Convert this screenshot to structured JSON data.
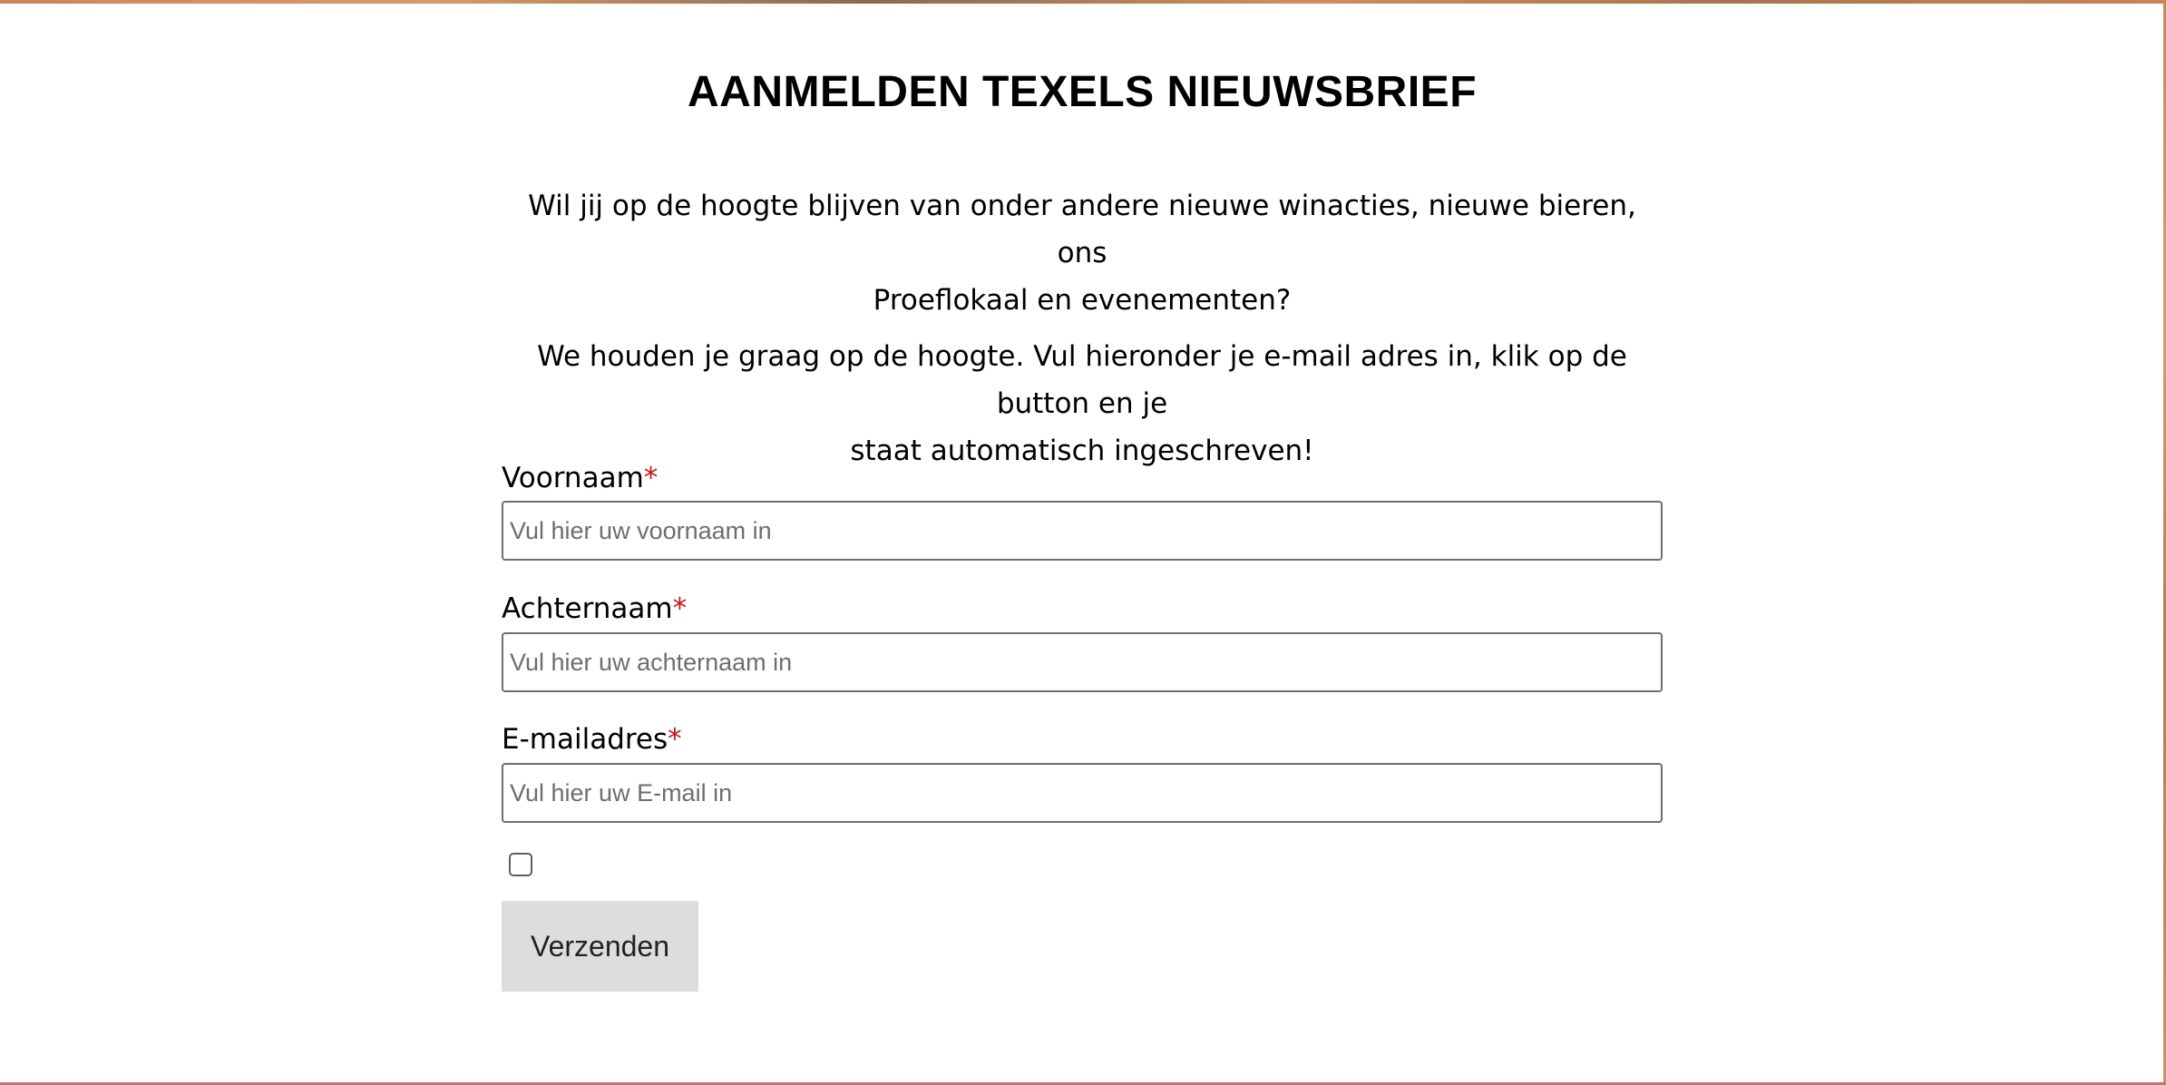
{
  "page": {
    "title": "AANMELDEN TEXELS NIEUWSBRIEF",
    "intro_paragraph_1_line_1": "Wil jij op de hoogte blijven van onder andere nieuwe winacties, nieuwe bieren, ons",
    "intro_paragraph_1_line_2": "Proeflokaal en evenementen?",
    "intro_paragraph_2_line_1": "We houden je graag op de hoogte. Vul hieronder je e-mail adres in, klik op de button en je",
    "intro_paragraph_2_line_2": "staat automatisch ingeschreven!"
  },
  "form": {
    "required_marker": "*",
    "first_name": {
      "label": "Voornaam",
      "value": "",
      "placeholder": "Vul hier uw voornaam in"
    },
    "last_name": {
      "label": "Achternaam",
      "value": "",
      "placeholder": "Vul hier uw achternaam in"
    },
    "email": {
      "label": "E-mailadres",
      "value": "",
      "placeholder": "Vul hier uw E-mail in"
    },
    "consent_checked": false,
    "submit_label": "Verzenden"
  },
  "colors": {
    "required_star": "#c0141a",
    "button_background": "#dddddd",
    "input_border": "#6f6f6f",
    "bottom_border": "#c7716a"
  }
}
